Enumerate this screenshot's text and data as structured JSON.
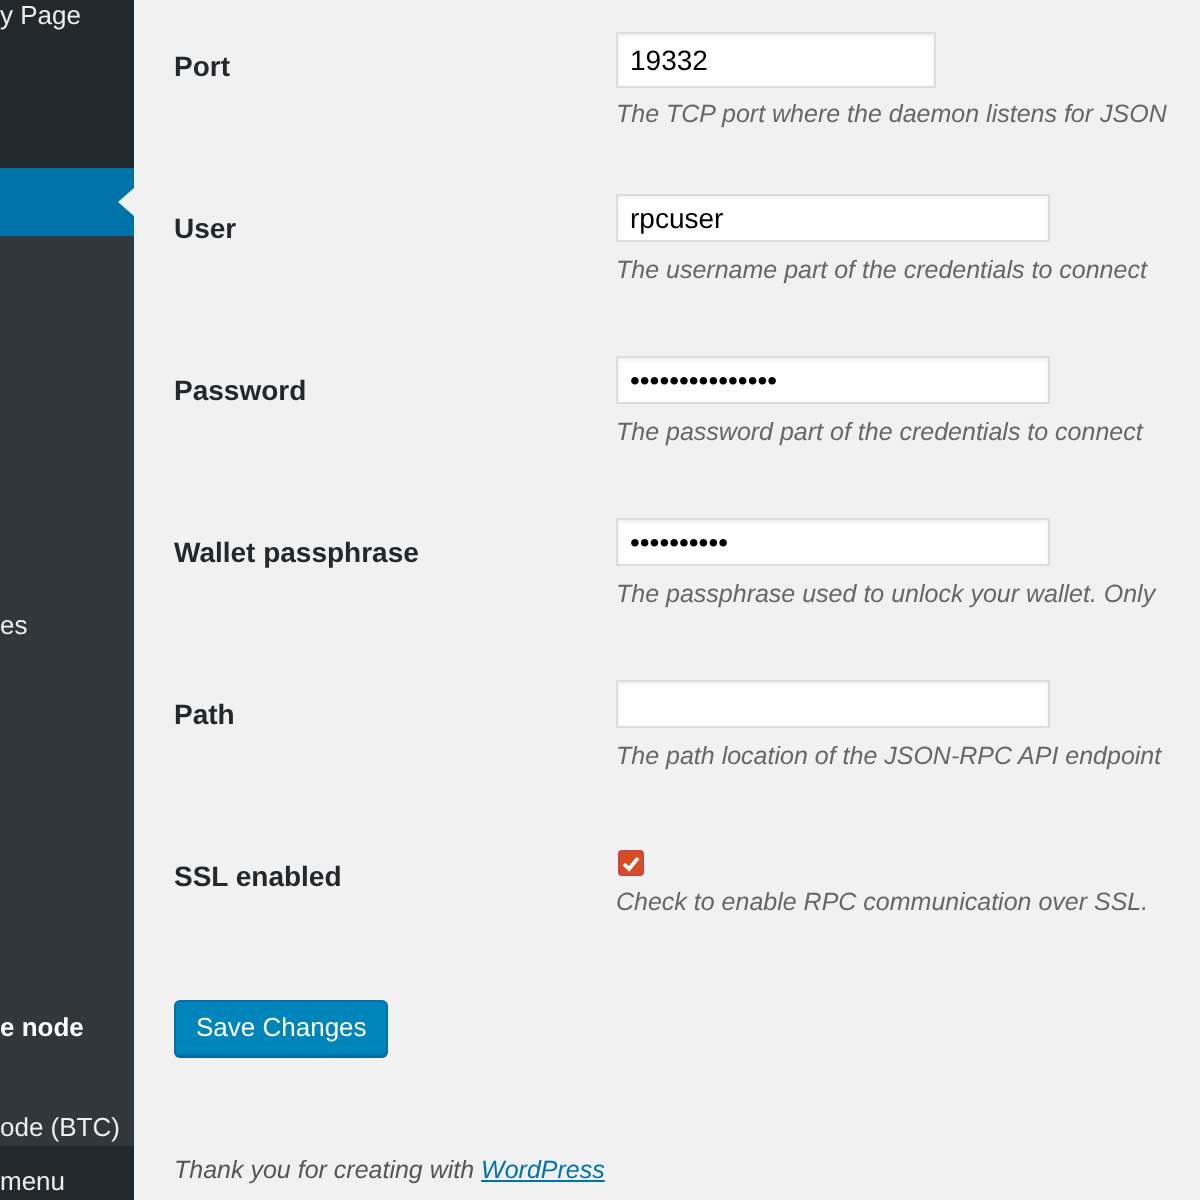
{
  "sidebar": {
    "items": [
      {
        "label": "y Page",
        "kind": "item",
        "selected": false
      },
      {
        "kind": "item",
        "selected": true
      },
      {
        "label": "es",
        "kind": "item",
        "selected": false
      },
      {
        "label": "e node",
        "kind": "heading",
        "selected": false
      },
      {
        "label": "ode (BTC)",
        "kind": "item",
        "selected": false
      }
    ],
    "collapse": "menu"
  },
  "fields": [
    {
      "label": "Port",
      "kind": "number",
      "value": "19332",
      "description": "The TCP port where the daemon listens for JSON"
    },
    {
      "label": "User",
      "kind": "text",
      "value": "rpcuser",
      "description": "The username part of the credentials to connect"
    },
    {
      "label": "Password",
      "kind": "password",
      "value": "•••••••••••••••",
      "description": "The password part of the credentials to connect"
    },
    {
      "label": "Wallet passphrase",
      "kind": "password",
      "value": "••••••••••",
      "description": "The passphrase used to unlock your wallet. Only"
    },
    {
      "label": "Path",
      "kind": "text",
      "description": "The path location of the JSON-RPC API endpoint"
    },
    {
      "label": "SSL enabled",
      "kind": "checkbox",
      "checked": true,
      "description": "Check to enable RPC communication over SSL."
    }
  ],
  "save_button": "Save Changes",
  "footer": {
    "text": "Thank you for creating with",
    "link": "WordPress"
  }
}
